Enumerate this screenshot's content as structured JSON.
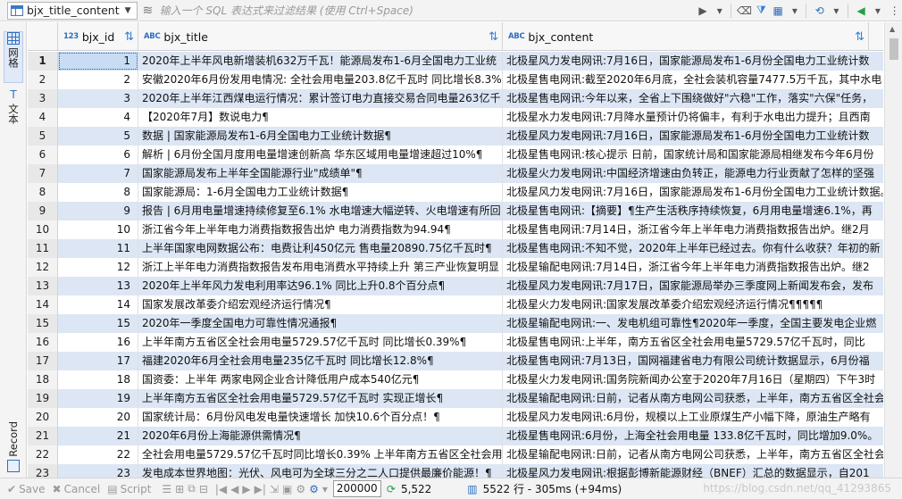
{
  "filter_bar": {
    "table_name": "bjx_title_content",
    "filter_placeholder": "输入一个 SQL 表达式来过滤结果 (使用 Ctrl+Space)"
  },
  "left_panel": {
    "grid_label": "网格",
    "text_label": "文本",
    "record_label": "Record"
  },
  "columns": [
    {
      "type": "123",
      "name": "bjx_id"
    },
    {
      "type": "ABC",
      "name": "bjx_title"
    },
    {
      "type": "ABC",
      "name": "bjx_content"
    }
  ],
  "rows": [
    {
      "n": "1",
      "id": "1",
      "title": "2020年上半年风电新增装机632万千瓦！能源局发布1-6月全国电力工业统",
      "content": "北极星风力发电网讯:7月16日，国家能源局发布1-6月份全国电力工业统计数"
    },
    {
      "n": "2",
      "id": "2",
      "title": "安徽2020年6月份发用电情况: 全社会用电量203.8亿千瓦时 同比增长8.3%¶",
      "content": "北极星售电网讯:截至2020年6月底，全社会装机容量7477.5万千瓦，其中水电"
    },
    {
      "n": "3",
      "id": "3",
      "title": "2020年上半年江西煤电运行情况：累计签订电力直接交易合同电量263亿千",
      "content": "北极星售电网讯:今年以来，全省上下围绕做好\"六稳\"工作，落实\"六保\"任务，"
    },
    {
      "n": "4",
      "id": "4",
      "title": "【2020年7月】数说电力¶",
      "content": "北极星水力发电网讯:7月降水量预计仍将偏丰，有利于水电出力提升；且西南"
    },
    {
      "n": "5",
      "id": "5",
      "title": "数据 | 国家能源局发布1-6月全国电力工业统计数据¶",
      "content": "北极星风力发电网讯:7月16日，国家能源局发布1-6月份全国电力工业统计数"
    },
    {
      "n": "6",
      "id": "6",
      "title": "解析 | 6月份全国月度用电量增速创新高 华东区域用电量增速超过10%¶",
      "content": "北极星售电网讯:核心提示 日前，国家统计局和国家能源局相继发布今年6月份"
    },
    {
      "n": "7",
      "id": "7",
      "title": "国家能源局发布上半年全国能源行业\"成绩单\"¶",
      "content": "北极星火力发电网讯:中国经济增速由负转正，能源电力行业贡献了怎样的坚强"
    },
    {
      "n": "8",
      "id": "8",
      "title": "国家能源局：1-6月全国电力工业统计数据¶",
      "content": "北极星风力发电网讯:7月16日，国家能源局发布1-6月份全国电力工业统计数据。"
    },
    {
      "n": "9",
      "id": "9",
      "title": "报告 | 6月用电量增速持续修复至6.1% 水电增速大幅逆转、火电增速有所回",
      "content": "北极星售电网讯:【摘要】¶生产生活秩序持续恢复，6月用电量增速6.1%，再"
    },
    {
      "n": "10",
      "id": "10",
      "title": "浙江省今年上半年电力消费指数报告出炉 电力消费指数为94.94¶",
      "content": "北极星售电网讯:7月14日，浙江省今年上半年电力消费指数报告出炉。继2月"
    },
    {
      "n": "11",
      "id": "11",
      "title": "上半年国家电网数据公布：电费让利450亿元 售电量20890.75亿千瓦时¶",
      "content": "北极星售电网讯:不知不觉，2020年上半年已经过去。你有什么收获？年初的新"
    },
    {
      "n": "12",
      "id": "12",
      "title": "浙江上半年电力消费指数报告发布用电消费水平持续上升 第三产业恢复明显",
      "content": "北极星输配电网讯:7月14日，浙江省今年上半年电力消费指数报告出炉。继2"
    },
    {
      "n": "13",
      "id": "13",
      "title": "2020年上半年风力发电利用率达96.1% 同比上升0.8个百分点¶",
      "content": "北极星风力发电网讯:7月17日，国家能源局举办三季度网上新闻发布会，发布"
    },
    {
      "n": "14",
      "id": "14",
      "title": "国家发展改革委介绍宏观经济运行情况¶",
      "content": "北极星火力发电网讯:国家发展改革委介绍宏观经济运行情况¶¶¶¶¶"
    },
    {
      "n": "15",
      "id": "15",
      "title": "2020年一季度全国电力可靠性情况通报¶",
      "content": "北极星输配电网讯:一、发电机组可靠性¶2020年一季度，全国主要发电企业燃"
    },
    {
      "n": "16",
      "id": "16",
      "title": "上半年南方五省区全社会用电量5729.57亿千瓦时 同比增长0.39%¶",
      "content": "北极星售电网讯:上半年，南方五省区全社会用电量5729.57亿千瓦时，同比"
    },
    {
      "n": "17",
      "id": "17",
      "title": "福建2020年6月全社会用电量235亿千瓦时 同比增长12.8%¶",
      "content": "北极星售电网讯:7月13日，国网福建省电力有限公司统计数据显示，6月份福"
    },
    {
      "n": "18",
      "id": "18",
      "title": "国资委：上半年 两家电网企业合计降低用户成本540亿元¶",
      "content": "北极星火力发电网讯:国务院新闻办公室于2020年7月16日（星期四）下午3时"
    },
    {
      "n": "19",
      "id": "19",
      "title": "上半年南方五省区全社会用电量5729.57亿千瓦时 实现正增长¶",
      "content": "北极星输配电网讯:日前，记者从南方电网公司获悉，上半年，南方五省区全社会"
    },
    {
      "n": "20",
      "id": "20",
      "title": "国家统计局：6月份风电发电量快速增长 加快10.6个百分点！¶",
      "content": "北极星风力发电网讯:6月份，规模以上工业原煤生产小幅下降，原油生产略有"
    },
    {
      "n": "21",
      "id": "21",
      "title": "2020年6月份上海能源供需情况¶",
      "content": "北极星售电网讯:6月份，上海全社会用电量 133.8亿千瓦时，同比增加9.0%。"
    },
    {
      "n": "22",
      "id": "22",
      "title": "全社会用电量5729.57亿千瓦时同比增长0.39% 上半年南方五省区全社会用电",
      "content": "北极星输配电网讯:日前，记者从南方电网公司获悉，上半年，南方五省区全社会"
    },
    {
      "n": "23",
      "id": "23",
      "title": "发电成本世界地图：光伏、风电可为全球三分之二人口提供最廉价能源！¶",
      "content": "北极星风力发电网讯:根据彭博新能源财经（BNEF）汇总的数据显示，自201"
    }
  ],
  "status_bar": {
    "save_label": "Save",
    "cancel_label": "Cancel",
    "script_label": "Script",
    "fetch_size": "200000",
    "record_count": "5,522",
    "rows_info": "5522 行 - 305ms (+94ms)",
    "watermark": "https://blog.csdn.net/qq_41293865"
  }
}
